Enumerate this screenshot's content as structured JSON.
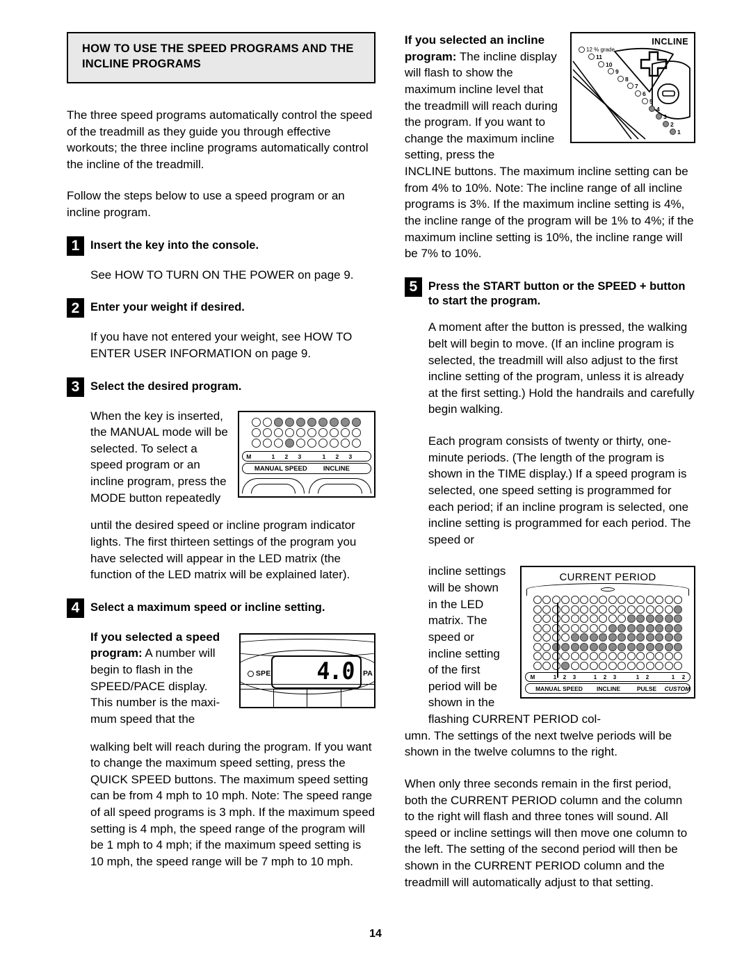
{
  "page": {
    "number": "14",
    "title": "HOW TO USE THE SPEED PROGRAMS AND THE INCLINE PROGRAMS"
  },
  "left_column": {
    "intro_1": "The three speed programs automatically control the speed of the treadmill as they guide you through effective workouts; the three incline programs automatically control the incline of the treadmill.",
    "intro_2": "Follow the steps below to use a speed program or an incline program.",
    "steps": [
      {
        "number": "1",
        "heading": "Insert the key into the console.",
        "body": "See HOW TO TURN ON THE POWER on page 9."
      },
      {
        "number": "2",
        "heading": "Enter your weight if desired.",
        "body": "If you have not entered your weight, see HOW TO ENTER USER INFORMATION on page 9."
      },
      {
        "number": "3",
        "heading": "Select the desired program.",
        "body_wrap": "When the key is inserted, the MANUAL mode will be selected. To select a speed program or an incline program, press the MODE button repeatedly",
        "body_rest": "until the desired speed or incline program indicator lights. The first thirteen settings of the program you have selected will appear in the LED matrix (the function of the LED matrix will be explained later)."
      },
      {
        "number": "4",
        "heading": "Select a maximum speed or incline setting.",
        "body_bold": "If you selected a speed program:",
        "body_wrap": " A number will begin to flash in the SPEED/PACE display. This number is the maxi-mum speed that the",
        "body_rest": "walking belt will reach during the program. If you want to change the maximum speed setting, press the QUICK SPEED buttons. The maximum speed setting can be from 4 mph to 10 mph. Note: The speed range of all speed programs is 3 mph. If the maximum speed setting is 4 mph, the speed range of the program will be 1 mph to 4 mph; if the maximum speed setting is 10 mph, the speed range will be 7 mph to 10 mph."
      }
    ]
  },
  "right_column": {
    "incline_intro_bold": "If you selected an incline program:",
    "incline_intro_wrap": " The incline display will flash to show the maximum incline level that the treadmill will reach during the program. If you want to change the maximum incline setting, press the",
    "incline_intro_rest": "INCLINE buttons. The maximum incline setting can be from 4% to 10%. Note: The incline range of all incline programs is 3%. If the maximum incline setting is 4%, the incline range of the program will be 1% to 4%; if the maximum incline setting is 10%, the incline range will be 7% to 10%.",
    "step5": {
      "number": "5",
      "heading": "Press the START button or the SPEED + button to start the program.",
      "body_1": "A moment after the button is pressed, the walking belt will begin to move. (If an incline program is selected, the treadmill will also adjust to the first incline setting of the program, unless it is already at the first setting.) Hold the handrails and carefully begin walking.",
      "body_2": "Each program consists of twenty or thirty, one-minute periods. (The length of the program is shown in the TIME display.) If a speed program is selected, one speed setting is programmed for each period; if an incline program is selected, one incline setting is programmed for each period. The speed or",
      "body_3_wrap": "incline settings will be shown in the LED matrix. The speed or incline setting of the first period will be shown in the flashing CURRENT PERIOD col-",
      "body_3_rest": "umn. The settings of the next twelve periods will be shown in the twelve columns to the right.",
      "body_4": "When only three seconds remain in the first period, both the CURRENT PERIOD column and the column to the right will flash and three tones will sound. All speed or incline settings will then move one column to the left. The setting of the second period will then be shown in the CURRENT PERIOD column and the treadmill will automatically adjust to that setting."
    }
  },
  "figures": {
    "console_small": {
      "rows": [
        [
          0,
          0,
          1,
          1,
          1,
          1,
          1,
          1,
          1,
          1
        ],
        [
          0,
          0,
          0,
          0,
          0,
          0,
          0,
          0,
          0,
          0
        ],
        [
          0,
          0,
          0,
          1,
          0,
          0,
          0,
          0,
          0,
          0
        ]
      ],
      "tick_labels": [
        "M",
        "1",
        "2",
        "3",
        "1",
        "2",
        "3"
      ],
      "group_labels": [
        "MANUAL SPEED",
        "INCLINE"
      ]
    },
    "speed_display": {
      "value": "4.0",
      "speed_label": "SPEED",
      "pace_label": "PA"
    },
    "incline_panel": {
      "title": "INCLINE",
      "grade_label": "12 % grade",
      "levels": [
        {
          "n": "12",
          "on": false
        },
        {
          "n": "11",
          "on": false
        },
        {
          "n": "10",
          "on": false
        },
        {
          "n": "9",
          "on": false
        },
        {
          "n": "8",
          "on": false
        },
        {
          "n": "7",
          "on": false
        },
        {
          "n": "6",
          "on": false
        },
        {
          "n": "5",
          "on": false
        },
        {
          "n": "4",
          "on": true
        },
        {
          "n": "3",
          "on": true
        },
        {
          "n": "2",
          "on": true
        },
        {
          "n": "1",
          "on": true
        }
      ]
    },
    "current_period": {
      "title": "CURRENT PERIOD",
      "rows": [
        [
          0,
          0,
          0,
          0,
          0,
          0,
          0,
          0,
          0,
          0,
          0,
          0,
          0,
          0,
          0,
          0
        ],
        [
          0,
          0,
          0,
          0,
          0,
          0,
          0,
          0,
          0,
          0,
          0,
          0,
          0,
          0,
          0,
          1
        ],
        [
          0,
          0,
          0,
          0,
          0,
          0,
          0,
          0,
          0,
          0,
          1,
          1,
          1,
          1,
          1,
          1
        ],
        [
          0,
          0,
          0,
          0,
          0,
          0,
          0,
          0,
          1,
          1,
          1,
          1,
          1,
          1,
          1,
          1
        ],
        [
          0,
          0,
          0,
          0,
          1,
          1,
          1,
          1,
          1,
          1,
          1,
          1,
          1,
          1,
          1,
          1
        ],
        [
          0,
          0,
          1,
          1,
          1,
          1,
          1,
          1,
          1,
          1,
          1,
          1,
          1,
          1,
          1,
          1
        ],
        [
          0,
          0,
          0,
          0,
          0,
          0,
          0,
          0,
          0,
          0,
          0,
          0,
          0,
          0,
          0,
          0
        ],
        [
          0,
          0,
          0,
          1,
          0,
          0,
          0,
          0,
          0,
          0,
          0,
          0,
          0,
          0,
          0,
          0
        ]
      ],
      "tick_labels": [
        "M",
        "1",
        "2",
        "3",
        "1",
        "2",
        "3",
        "1",
        "2",
        "1",
        "2"
      ],
      "group_labels": [
        "MANUAL SPEED",
        "INCLINE",
        "PULSE",
        "CUSTOM"
      ]
    }
  }
}
